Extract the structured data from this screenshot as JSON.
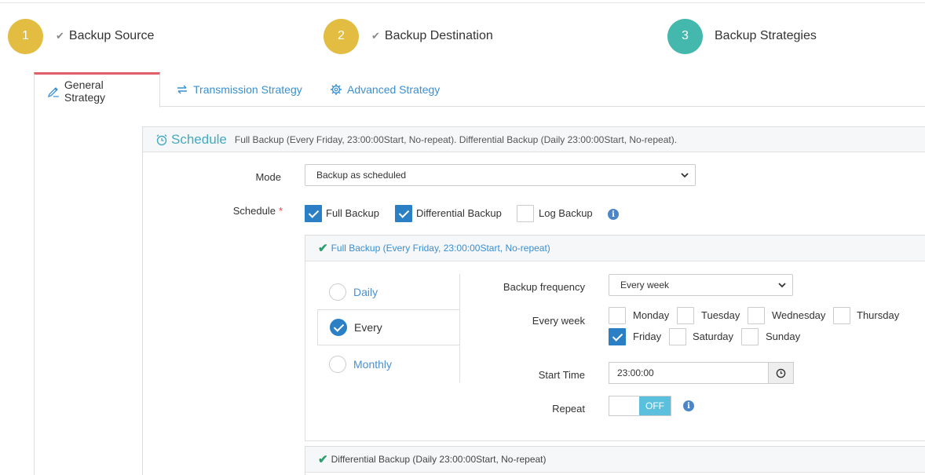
{
  "steps": [
    {
      "number": "1",
      "label": "Backup Source",
      "done": true
    },
    {
      "number": "2",
      "label": "Backup Destination",
      "done": true
    },
    {
      "number": "3",
      "label": "Backup Strategies",
      "done": false
    }
  ],
  "tabs": [
    {
      "label": "General Strategy",
      "icon": "pencil-icon",
      "active": true
    },
    {
      "label": "Transmission Strategy",
      "icon": "transfer-arrows-icon",
      "active": false
    },
    {
      "label": "Advanced Strategy",
      "icon": "gear-icon",
      "active": false
    }
  ],
  "schedule": {
    "title": "Schedule",
    "summary": "Full Backup (Every Friday, 23:00:00Start, No-repeat). Differential Backup (Daily 23:00:00Start, No-repeat).",
    "mode_label": "Mode",
    "mode_value": "Backup as scheduled",
    "schedule_label": "Schedule",
    "required_mark": "*",
    "types": [
      {
        "label": "Full Backup",
        "checked": true
      },
      {
        "label": "Differential Backup",
        "checked": true
      },
      {
        "label": "Log Backup",
        "checked": false
      }
    ]
  },
  "full_backup": {
    "header": "Full Backup (Every Friday, 23:00:00Start, No-repeat)",
    "periods": [
      {
        "label": "Daily",
        "selected": false
      },
      {
        "label": "Every",
        "selected": true
      },
      {
        "label": "Monthly",
        "selected": false
      }
    ],
    "frequency_label": "Backup frequency",
    "frequency_value": "Every week",
    "every_week_label": "Every week",
    "days": [
      {
        "label": "Monday",
        "checked": false
      },
      {
        "label": "Tuesday",
        "checked": false
      },
      {
        "label": "Wednesday",
        "checked": false
      },
      {
        "label": "Thursday",
        "checked": false
      },
      {
        "label": "Friday",
        "checked": true
      },
      {
        "label": "Saturday",
        "checked": false
      },
      {
        "label": "Sunday",
        "checked": false
      }
    ],
    "start_time_label": "Start Time",
    "start_time_value": "23:00:00",
    "repeat_label": "Repeat",
    "repeat_state": "OFF"
  },
  "differential_backup": {
    "header": "Differential Backup (Daily 23:00:00Start, No-repeat)"
  },
  "colors": {
    "step_done": "#e2bd42",
    "step_active": "#45b8ad",
    "tab_active_border": "#e0606a",
    "link": "#3a8fd0",
    "checkbox_on": "#2b7fc5",
    "toggle_off": "#5bc0de"
  }
}
